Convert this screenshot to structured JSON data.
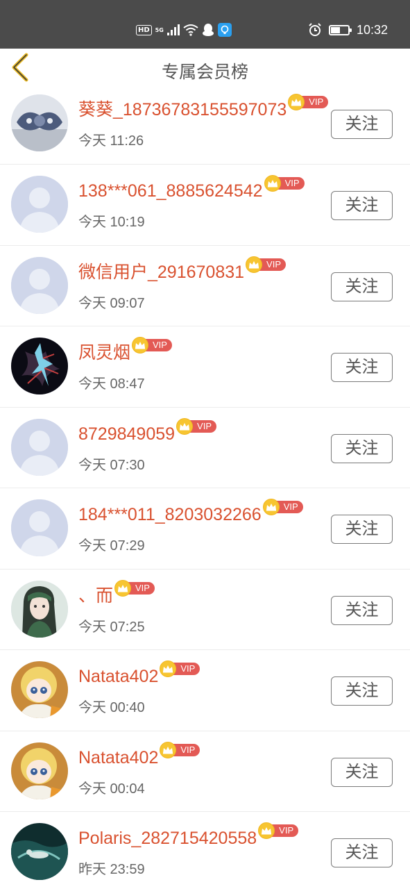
{
  "status_bar": {
    "network_hd": "HD",
    "network_5g": "5G",
    "time": "10:32",
    "battery_level": 0.5,
    "icons": [
      "hd-icon",
      "5g-signal-icon",
      "wifi-icon",
      "qq-icon",
      "notification-app-icon",
      "alarm-icon",
      "battery-icon"
    ]
  },
  "header": {
    "title": "专属会员榜",
    "back_icon": "chevron-left-icon",
    "accent_color": "#e9b820"
  },
  "vip_label": "VIP",
  "colors": {
    "name": "#d9512f",
    "vip_badge": "#e35a55",
    "crown": "#f7c531"
  },
  "members": [
    {
      "name": "葵葵_18736783155597073",
      "time": "今天 11:26",
      "follow_label": "关注",
      "avatar": "ornament-avatar"
    },
    {
      "name": "138***061_8885624542",
      "time": "今天 10:19",
      "follow_label": "关注",
      "avatar": "default-avatar"
    },
    {
      "name": "微信用户_291670831",
      "time": "今天 09:07",
      "follow_label": "关注",
      "avatar": "default-avatar"
    },
    {
      "name": "凤灵烟",
      "time": "今天 08:47",
      "follow_label": "关注",
      "avatar": "lightning-avatar"
    },
    {
      "name": "8729849059",
      "time": "今天 07:30",
      "follow_label": "关注",
      "avatar": "default-avatar"
    },
    {
      "name": "184***011_8203032266",
      "time": "今天 07:29",
      "follow_label": "关注",
      "avatar": "default-avatar"
    },
    {
      "name": "、而",
      "time": "今天 07:25",
      "follow_label": "关注",
      "avatar": "girl-avatar"
    },
    {
      "name": "Natata402",
      "time": "今天 00:40",
      "follow_label": "关注",
      "avatar": "doll-avatar"
    },
    {
      "name": "Natata402",
      "time": "今天 00:04",
      "follow_label": "关注",
      "avatar": "doll-avatar"
    },
    {
      "name": "Polaris_282715420558",
      "time": "昨天 23:59",
      "follow_label": "关注",
      "avatar": "swimmer-avatar"
    }
  ]
}
